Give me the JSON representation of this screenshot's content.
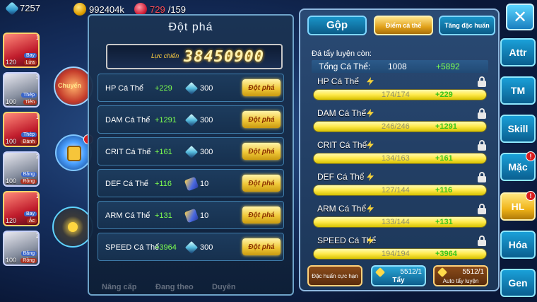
{
  "top_bar": {
    "diamonds": "7257",
    "gold": "992404k",
    "energy_current": "729",
    "energy_max": "/159"
  },
  "team": [
    {
      "level": "120",
      "tag": "Bay",
      "tag2": "Lửa",
      "num": "1"
    },
    {
      "level": "100",
      "tag": "Thép",
      "tag2": "Tiên",
      "num": "3"
    },
    {
      "level": "100",
      "tag": "Thép",
      "tag2": "Đánh",
      "num": "1"
    },
    {
      "level": "100",
      "tag": "Băng",
      "tag2": "Rồng",
      "num": "2"
    },
    {
      "level": "120",
      "tag": "Bay",
      "tag2": "Ác",
      "num": "1"
    },
    {
      "level": "100",
      "tag": "Băng",
      "tag2": "Rồng",
      "num": "2"
    }
  ],
  "side_labels": {
    "w1": "Chuyển",
    "badge": "!"
  },
  "breakthrough": {
    "title": "Đột phá",
    "power_label": "Lực chiến",
    "power_value": "38450900",
    "button_label": "Đột phá",
    "rows": [
      {
        "label": "HP Cá Thể",
        "bonus": "+229",
        "cost_icon": "diamond-icon",
        "cost": "300"
      },
      {
        "label": "DAM Cá Thể",
        "bonus": "+1291",
        "cost_icon": "diamond-icon",
        "cost": "300"
      },
      {
        "label": "CRIT Cá Thể",
        "bonus": "+161",
        "cost_icon": "diamond-icon",
        "cost": "300"
      },
      {
        "label": "DEF Cá Thể",
        "bonus": "+116",
        "cost_icon": "wand-icon",
        "cost": "10"
      },
      {
        "label": "ARM Cá Thể",
        "bonus": "+131",
        "cost_icon": "wand-icon",
        "cost": "10"
      },
      {
        "label": "SPEED Cá Thể",
        "bonus": "+3964",
        "cost_icon": "diamond-icon",
        "cost": "300"
      }
    ]
  },
  "under_tabs": [
    "Nâng cấp",
    "Đang theo",
    "Duyên"
  ],
  "main": {
    "tabs": [
      "Gộp",
      "Điểm cá thể",
      "Tăng đặc huấn"
    ],
    "remaining_label": "Đá tẩy luyện còn:",
    "total_label": "Tổng Cá Thể:",
    "total_value": "1008",
    "total_bonus": "+5892",
    "stats": [
      {
        "name": "HP Cá Thể",
        "current": "174/174",
        "bonus": "+229",
        "fill": 1.0
      },
      {
        "name": "DAM Cá Thể",
        "current": "246/246",
        "bonus": "+1291",
        "fill": 1.0
      },
      {
        "name": "CRIT Cá Thể",
        "current": "134/163",
        "bonus": "+161",
        "fill": 1.0
      },
      {
        "name": "DEF Cá Thể",
        "current": "127/144",
        "bonus": "+116",
        "fill": 1.0
      },
      {
        "name": "ARM Cá Thể",
        "current": "133/144",
        "bonus": "+131",
        "fill": 1.0
      },
      {
        "name": "SPEED Cá Thể",
        "current": "194/194",
        "bonus": "+3964",
        "fill": 1.0
      }
    ],
    "bottom": {
      "special_label": "Đặc huấn cực hạn",
      "wash_count": "5512/1",
      "wash_label": "Tẩy",
      "auto_count": "5512/1",
      "auto_label": "Auto tẩy luyện"
    }
  },
  "nav": [
    {
      "label": "Attr",
      "active": false,
      "badge": ""
    },
    {
      "label": "TM",
      "active": false,
      "badge": ""
    },
    {
      "label": "Skill",
      "active": false,
      "badge": ""
    },
    {
      "label": "Mặc",
      "active": false,
      "badge": "!"
    },
    {
      "label": "HL",
      "active": true,
      "badge": "!"
    },
    {
      "label": "Hóa",
      "active": false,
      "badge": ""
    },
    {
      "label": "Gen",
      "active": false,
      "badge": ""
    }
  ],
  "close_label": "✕"
}
